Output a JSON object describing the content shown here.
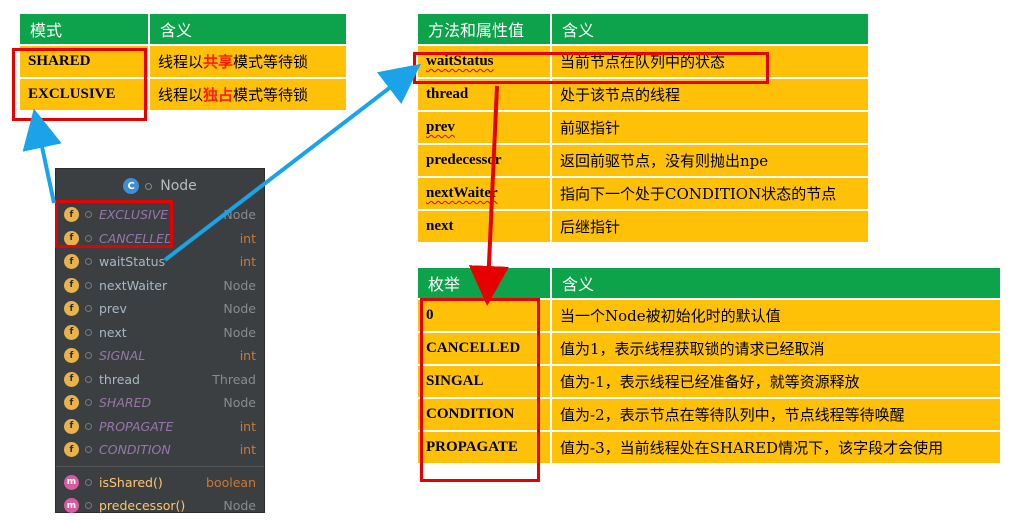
{
  "mode_table": {
    "header": [
      "模式",
      "含义"
    ],
    "rows": [
      {
        "name": "SHARED",
        "pre": "线程以",
        "hl": "共享",
        "post": "模式等待锁"
      },
      {
        "name": "EXCLUSIVE",
        "pre": "线程以",
        "hl": "独占",
        "post": "模式等待锁"
      }
    ]
  },
  "props_table": {
    "header": [
      "方法和属性值",
      "含义"
    ],
    "rows": [
      {
        "name": "waitStatus",
        "desc": "当前节点在队列中的状态"
      },
      {
        "name": "thread",
        "desc": "处于该节点的线程"
      },
      {
        "name": "prev",
        "desc": "前驱指针"
      },
      {
        "name": "predecessor",
        "desc": "返回前驱节点，没有则抛出npe"
      },
      {
        "name": "nextWaiter",
        "desc": "指向下一个处于CONDITION状态的节点"
      },
      {
        "name": "next",
        "desc": "后继指针"
      }
    ]
  },
  "enum_table": {
    "header": [
      "枚举",
      "含义"
    ],
    "rows": [
      {
        "name": "0",
        "desc": "当一个Node被初始化时的默认值"
      },
      {
        "name": "CANCELLED",
        "desc": "值为1，表示线程获取锁的请求已经取消"
      },
      {
        "name": "SINGAL",
        "desc": "值为-1，表示线程已经准备好，就等资源释放"
      },
      {
        "name": "CONDITION",
        "desc": "值为-2，表示节点在等待队列中，节点线程等待唤醒"
      },
      {
        "name": "PROPAGATE",
        "desc": "值为-3，当前线程处在SHARED情况下，该字段才会使用"
      }
    ]
  },
  "ide_panel": {
    "title": "Node",
    "fields": [
      {
        "name": "EXCLUSIVE",
        "type": "Node",
        "static": true
      },
      {
        "name": "CANCELLED",
        "type": "int",
        "static": true
      },
      {
        "name": "waitStatus",
        "type": "int",
        "static": false
      },
      {
        "name": "nextWaiter",
        "type": "Node",
        "static": false
      },
      {
        "name": "prev",
        "type": "Node",
        "static": false
      },
      {
        "name": "next",
        "type": "Node",
        "static": false
      },
      {
        "name": "SIGNAL",
        "type": "int",
        "static": true
      },
      {
        "name": "thread",
        "type": "Thread",
        "static": false
      },
      {
        "name": "SHARED",
        "type": "Node",
        "static": true
      },
      {
        "name": "PROPAGATE",
        "type": "int",
        "static": true
      },
      {
        "name": "CONDITION",
        "type": "int",
        "static": true
      }
    ],
    "methods": [
      {
        "name": "isShared()",
        "type": "boolean"
      },
      {
        "name": "predecessor()",
        "type": "Node"
      }
    ]
  },
  "colors": {
    "header_green": "#0da34a",
    "row_yellow": "#ffc107",
    "highlight_red": "#ff1a00",
    "box_red": "#e60000",
    "arrow_blue": "#1aa3e8"
  }
}
